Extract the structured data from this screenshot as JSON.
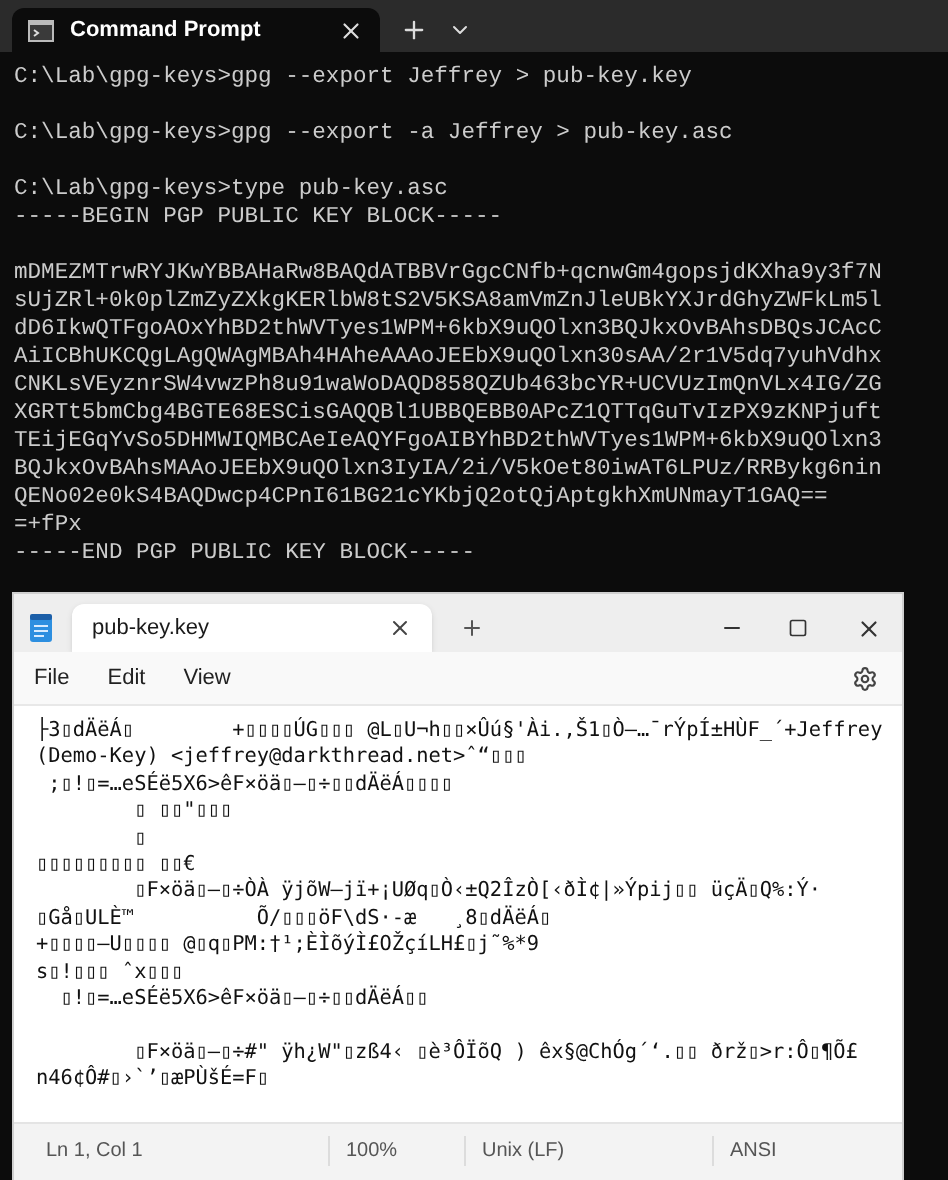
{
  "terminal": {
    "tab": {
      "title": "Command Prompt",
      "selected": true
    },
    "blocks": [
      [
        "C:\\Lab\\gpg-keys>gpg --export Jeffrey > pub-key.key"
      ],
      [
        "C:\\Lab\\gpg-keys>gpg --export -a Jeffrey > pub-key.asc"
      ],
      [
        "C:\\Lab\\gpg-keys>type pub-key.asc",
        "-----BEGIN PGP PUBLIC KEY BLOCK-----"
      ],
      [
        "mDMEZMTrwRYJKwYBBAHaRw8BAQdATBBVrGgcCNfb+qcnwGm4gopsjdKXha9y3f7N",
        "sUjZRl+0k0plZmZyZXkgKERlbW8tS2V5KSA8amVmZnJleUBkYXJrdGhyZWFkLm5l",
        "dD6IkwQTFgoAOxYhBD2thWVTyes1WPM+6kbX9uQOlxn3BQJkxOvBAhsDBQsJCAcC",
        "AiICBhUKCQgLAgQWAgMBAh4HAheAAAoJEEbX9uQOlxn30sAA/2r1V5dq7yuhVdhx",
        "CNKLsVEyznrSW4vwzPh8u91waWoDAQD858QZUb463bcYR+UCVUzImQnVLx4IG/ZG",
        "XGRTt5bmCbg4BGTE68ESCisGAQQBl1UBBQEBB0APcZ1QTTqGuTvIzPX9zKNPjuft",
        "TEijEGqYvSo5DHMWIQMBCAeIeAQYFgoAIBYhBD2thWVTyes1WPM+6kbX9uQOlxn3",
        "BQJkxOvBAhsMAAoJEEbX9uQOlxn3IyIA/2i/V5kOet80iwAT6LPUz/RRBykg6nin",
        "QENo02e0kS4BAQDwcp4CPnI61BG21cYKbjQ2otQjAptgkhXmUNmayT1GAQ==",
        "=+fPx",
        "-----END PGP PUBLIC KEY BLOCK-----"
      ]
    ]
  },
  "notepad": {
    "tab": {
      "title": "pub-key.key",
      "selected": true
    },
    "menu": [
      "File",
      "Edit",
      "View"
    ],
    "blocks": [
      [
        "├3▯dÄëÁ▯        +▯▯▯▯ÚG▯▯▯ @L▯U¬h▯▯×Ûú§'Ài.,Š1▯Ò—…¯rÝpÍ±HÙF_´+Jeffrey",
        "(Demo-Key) <jeffrey@darkthread.net>ˆ“▯▯▯",
        " ;▯!▯=…eSÉë5X6>êF×öä▯—▯÷▯▯dÄëÁ▯▯▯▯",
        "        ▯ ▯▯\"▯▯▯",
        "        ▯",
        "▯▯▯▯▯▯▯▯▯ ▯▯€",
        "        ▯F×öä▯—▯÷ÒÀ ÿjõW—jï+¡UØq▯Ò‹±Q2ÎzÒ[‹ðÌ¢|»Ýpij▯▯ üçÄ▯Q%:Ý·",
        "▯Gå▯ULÈ™          Õ/▯▯▯öF\\dS·-æ   ¸8▯dÄëÁ▯",
        "+▯▯▯▯—U▯▯▯▯ @▯q▯PM:†¹;ÈÌõýÌ£OŽçíLH£▯j˜%*9",
        "s▯!▯▯▯ ˆx▯▯▯",
        "  ▯!▯=…eSÉë5X6>êF×öä▯—▯÷▯▯dÄëÁ▯▯"
      ],
      [
        "        ▯F×öä▯—▯÷#\" ÿh¿W\"▯zß4‹ ▯è³ÔÏõQ ) êx§@ChÓg´‘.▯▯ ðrž▯>r:Ô▯¶Õ£",
        "n46¢Ô#▯›`’▯æPÙšÉ=F▯"
      ]
    ],
    "status_bar": [
      "Ln 1, Col 1",
      "100%",
      "Unix (LF)",
      "ANSI"
    ]
  }
}
